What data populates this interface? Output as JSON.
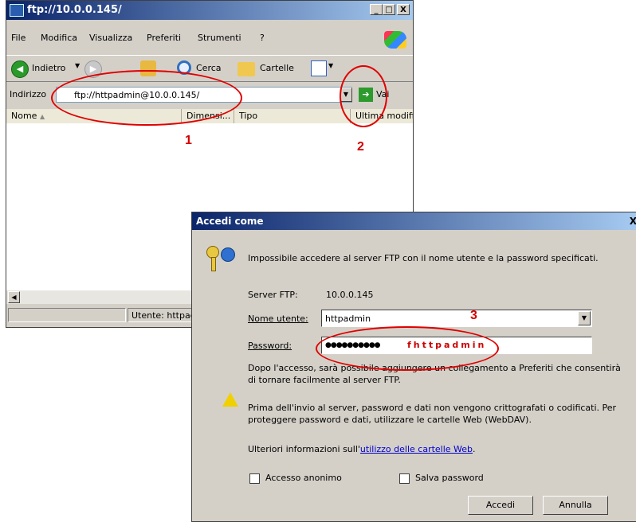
{
  "explorer": {
    "title": "ftp://10.0.0.145/",
    "controls": {
      "minimize": "_",
      "maximize": "□",
      "close": "X"
    },
    "menu": [
      "File",
      "Modifica",
      "Visualizza",
      "Preferiti",
      "Strumenti",
      "?"
    ],
    "toolbar": {
      "back": "Indietro",
      "search": "Cerca",
      "folders": "Cartelle"
    },
    "address": {
      "label": "Indirizzo",
      "value": "ftp://httpadmin@10.0.0.145/",
      "go": "Vai"
    },
    "columns": [
      "Nome",
      "Dimensi...",
      "Tipo",
      "Ultima modifi"
    ],
    "status": {
      "user": "Utente: httpad"
    }
  },
  "dialog": {
    "title": "Accedi come",
    "close": "X",
    "message": "Impossibile accedere al server FTP con il nome utente e la password specificati.",
    "server_label": "Server FTP:",
    "server_value": "10.0.0.145",
    "username_label": "Nome utente:",
    "username_value": "httpadmin",
    "password_label": "Password:",
    "password_dots": "●●●●●●●●●●",
    "password_hint": "fhttpadmin",
    "info_line1": "Dopo l'accesso, sarà possibile aggiungere un collegamento a Preferiti che consentirà",
    "info_line2": "di tornare facilmente al server FTP.",
    "warning_line1": "Prima dell'invio al server, password e dati non vengono crittografati o codificati. Per",
    "warning_line2": "proteggere password e dati, utilizzare le cartelle Web (WebDAV).",
    "more_info_prefix": "Ulteriori informazioni sull'",
    "more_info_link": "utilizzo delle cartelle Web",
    "more_info_suffix": ".",
    "anon_label": "Accesso anonimo",
    "save_password_label": "Salva password",
    "login_button": "Accedi",
    "cancel_button": "Annulla"
  },
  "annotations": [
    "1",
    "2",
    "3"
  ],
  "colors": {
    "annotation": "#e00000",
    "titlebar": "#0a246a"
  }
}
